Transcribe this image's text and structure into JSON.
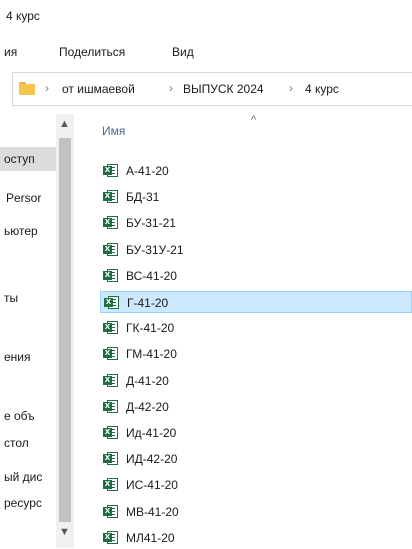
{
  "window": {
    "title": "4 курс"
  },
  "ribbon": {
    "tabs": [
      "ия",
      "Поделиться",
      "Вид"
    ]
  },
  "address": {
    "path": [
      "от ишмаевой",
      "ВЫПУСК 2024",
      "4 курс"
    ],
    "separator": "›"
  },
  "nav": {
    "items": [
      "оступ",
      "Persor",
      "ьютер",
      "ты",
      "ения",
      "е объ",
      "стол",
      "ый дис",
      "ресурс"
    ]
  },
  "list": {
    "column_name": "Имя",
    "sort_indicator": "^",
    "selected_index": 5,
    "files": [
      "А-41-20",
      "БД-31",
      "БУ-31-21",
      "БУ-31У-21",
      "ВС-41-20",
      "Г-41-20",
      "ГК-41-20",
      "ГМ-41-20",
      "Д-41-20",
      "Д-42-20",
      "Ид-41-20",
      "ИД-42-20",
      "ИС-41-20",
      "МВ-41-20",
      "МЛ41-20"
    ]
  }
}
